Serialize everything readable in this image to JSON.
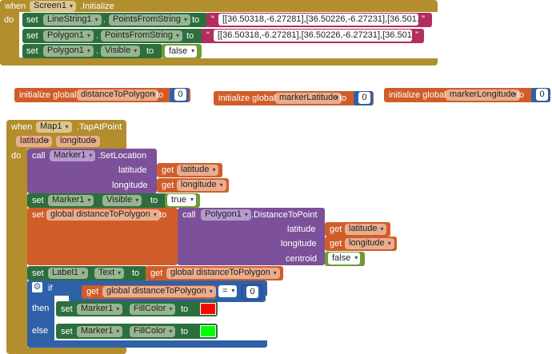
{
  "screen_init": {
    "when": "when",
    "component": "Screen1",
    "event": ".Initialize",
    "do": "do",
    "rows": [
      {
        "set": "set",
        "component": "LineString1",
        "dot": ".",
        "property": "PointsFromString",
        "to": "to",
        "value": "[[36.50318,-6.27281],[36.50226,-6.27231],[36.501..."
      },
      {
        "set": "set",
        "component": "Polygon1",
        "dot": ".",
        "property": "PointsFromString",
        "to": "to",
        "value": "[[36.50318,-6.27281],[36.50226,-6.27231],[36.501..."
      },
      {
        "set": "set",
        "component": "Polygon1",
        "dot": ".",
        "property": "Visible",
        "to": "to",
        "value": "false"
      }
    ]
  },
  "globals": [
    {
      "label": "initialize global",
      "name": "distanceToPolygon",
      "to": "to",
      "value": "0"
    },
    {
      "label": "initialize global",
      "name": "markerLatitude",
      "to": "to",
      "value": "0"
    },
    {
      "label": "initialize global",
      "name": "markerLongitude",
      "to": "to",
      "value": "0"
    }
  ],
  "tap": {
    "when": "when",
    "component": "Map1",
    "event": ".TapAtPoint",
    "params": [
      "latitude",
      "longitude"
    ],
    "do": "do",
    "setloc": {
      "call": "call",
      "component": "Marker1",
      "method": ".SetLocation",
      "arg1": "latitude",
      "arg2": "longitude",
      "get": "get",
      "get1": "latitude",
      "get2": "longitude"
    },
    "visible": {
      "set": "set",
      "component": "Marker1",
      "property": "Visible",
      "to": "to",
      "value": "true"
    },
    "setglobal": {
      "set": "set",
      "var": "global distanceToPolygon",
      "to": "to",
      "call": "call",
      "component": "Polygon1",
      "method": ".DistanceToPoint",
      "arg1": "latitude",
      "arg2": "longitude",
      "arg3": "centroid",
      "get": "get",
      "get1": "latitude",
      "get2": "longitude",
      "centroid": "false"
    },
    "label": {
      "set": "set",
      "component": "Label1",
      "property": "Text",
      "to": "to",
      "get": "get",
      "var": "global distanceToPolygon"
    },
    "ifblock": {
      "if": "if",
      "get": "get",
      "var": "global distanceToPolygon",
      "op": "=",
      "value": "0",
      "then": "then",
      "else": "else"
    },
    "then_set": {
      "set": "set",
      "component": "Marker1",
      "property": "FillColor",
      "to": "to",
      "color": "#ff0000"
    },
    "else_set": {
      "set": "set",
      "component": "Marker1",
      "property": "FillColor",
      "to": "to",
      "color": "#00ff00"
    }
  },
  "colors": {
    "event": "#b28e2d",
    "component_setter": "#2d6e3d",
    "method_call": "#7c5199",
    "variable": "#d05d29",
    "text": "#b32d5e",
    "logic": "#6e9b36",
    "math": "#2f61a8",
    "control": "#2f61a8"
  }
}
